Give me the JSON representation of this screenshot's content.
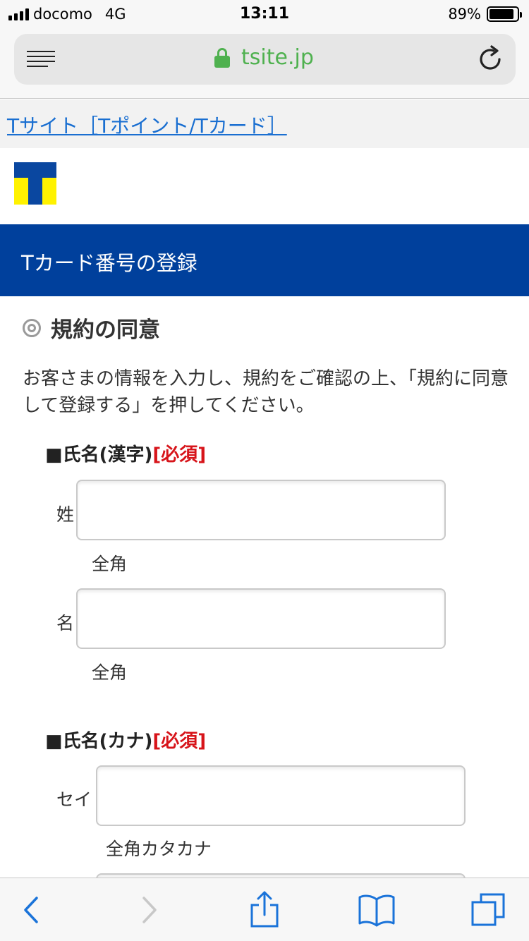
{
  "status_bar": {
    "carrier": "docomo",
    "network": "4G",
    "time": "13:11",
    "battery_percent": "89%",
    "battery_level": 0.89
  },
  "browser": {
    "url": "tsite.jp",
    "url_color": "#4fb14f"
  },
  "page": {
    "breadcrumb": "Tサイト［Tポイント/Tカード］",
    "header_title": "Tカード番号の登録",
    "header_color": "#00409c",
    "section_title": "規約の同意",
    "intro_text": "お客さまの情報を入力し、規約をご確認の上、「規約に同意して登録する」を押してください。",
    "required_color": "#d7141a"
  },
  "form": {
    "name_kanji": {
      "label": "■氏名(漢字)",
      "required": "[必須]",
      "last_label": "姓",
      "last_value": "",
      "last_hint": "全角",
      "first_label": "名",
      "first_value": "",
      "first_hint": "全角"
    },
    "name_kana": {
      "label": "■氏名(カナ)",
      "required": "[必須]",
      "last_label": "セイ",
      "last_value": "",
      "last_hint": "全角カタカナ"
    }
  },
  "icons": {
    "menu": "menu-icon",
    "lock": "lock-icon",
    "reload": "reload-icon",
    "back": "back-icon",
    "forward": "forward-icon",
    "share": "share-icon",
    "bookmarks": "bookmarks-icon",
    "tabs": "tabs-icon"
  }
}
